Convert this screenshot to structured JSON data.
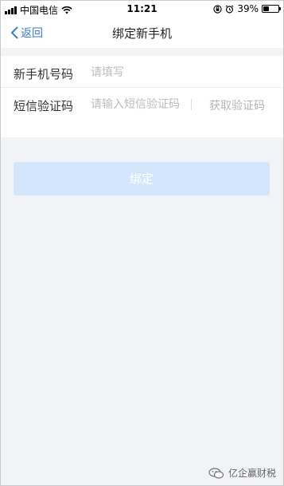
{
  "status_bar": {
    "carrier": "中国电信",
    "time": "11:21",
    "battery_text": "39%",
    "battery_level": 0.39,
    "icons": [
      "signal-icon",
      "wifi-icon",
      "rotation-lock-icon",
      "alarm-icon",
      "battery-icon"
    ]
  },
  "nav": {
    "back_label": "返回",
    "title": "绑定新手机"
  },
  "form": {
    "phone_label": "新手机号码",
    "phone_placeholder": "请填写",
    "sms_label": "短信验证码",
    "sms_placeholder": "请输入短信验证码",
    "get_code_label": "获取验证码"
  },
  "bind_button": "绑定",
  "watermark": "亿企赢财税",
  "colors": {
    "accent": "#3a7bd5",
    "button_disabled": "#d3e6fb",
    "background": "#f2f3f7"
  }
}
